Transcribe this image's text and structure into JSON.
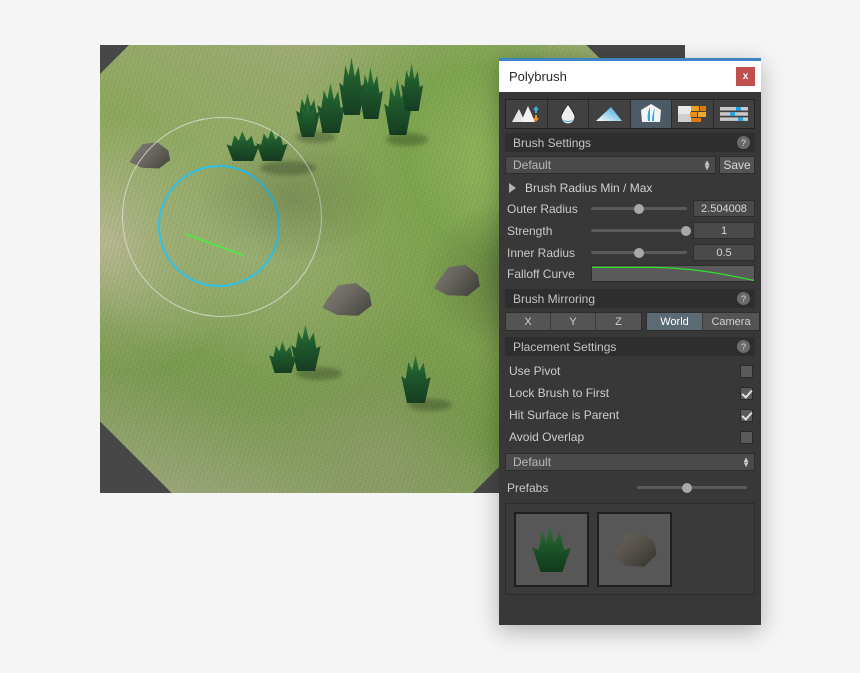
{
  "window": {
    "title": "Polybrush",
    "close_label": "x"
  },
  "toolbar": {
    "tools": [
      {
        "name": "raise-lower-icon",
        "tooltip": "Raise / Lower",
        "active": false
      },
      {
        "name": "smooth-icon",
        "tooltip": "Smooth",
        "active": false
      },
      {
        "name": "flatten-icon",
        "tooltip": "Flatten",
        "active": false
      },
      {
        "name": "paint-prefab-icon",
        "tooltip": "Place Prefabs",
        "active": true
      },
      {
        "name": "texture-paint-icon",
        "tooltip": "Texture Paint",
        "active": false
      },
      {
        "name": "vertex-color-icon",
        "tooltip": "Vertex Colors",
        "active": false
      }
    ]
  },
  "brush_settings": {
    "header": "Brush Settings",
    "help": "?",
    "preset": "Default",
    "save_label": "Save",
    "foldout_label": "Brush Radius Min / Max",
    "sliders": [
      {
        "label": "Outer Radius",
        "value": "2.504008",
        "fill": 50
      },
      {
        "label": "Strength",
        "value": "1",
        "fill": 100
      },
      {
        "label": "Inner Radius",
        "value": "0.5",
        "fill": 50
      }
    ],
    "falloff_label": "Falloff Curve",
    "curve_color": "#2ee02e"
  },
  "brush_mirroring": {
    "header": "Brush Mirroring",
    "help": "?",
    "axes": [
      {
        "label": "X",
        "on": false
      },
      {
        "label": "Y",
        "on": false
      },
      {
        "label": "Z",
        "on": false
      }
    ],
    "space": [
      {
        "label": "World",
        "on": true
      },
      {
        "label": "Camera",
        "on": false
      }
    ]
  },
  "placement_settings": {
    "header": "Placement Settings",
    "help": "?",
    "checkboxes": [
      {
        "label": "Use Pivot",
        "checked": false
      },
      {
        "label": "Lock Brush to First",
        "checked": true
      },
      {
        "label": "Hit Surface is Parent",
        "checked": true
      },
      {
        "label": "Avoid Overlap",
        "checked": false
      }
    ],
    "palette": "Default",
    "prefabs_label": "Prefabs",
    "prefabs_slider_fill": 45,
    "prefabs": [
      {
        "name": "grass-prefab",
        "kind": "grass"
      },
      {
        "name": "rock-prefab",
        "kind": "rock"
      }
    ]
  },
  "viewport": {
    "name": "scene-viewport",
    "background": "#474747",
    "gizmo": {
      "inner_color": "#2ec2e8",
      "outer_color": "#e4e4e4",
      "normal_color": "#5ae04a"
    }
  },
  "colors": {
    "accent": "#3d86c6",
    "close": "#c0504d",
    "panel_bg": "#383838",
    "page_bg": "#f5f5f5"
  }
}
